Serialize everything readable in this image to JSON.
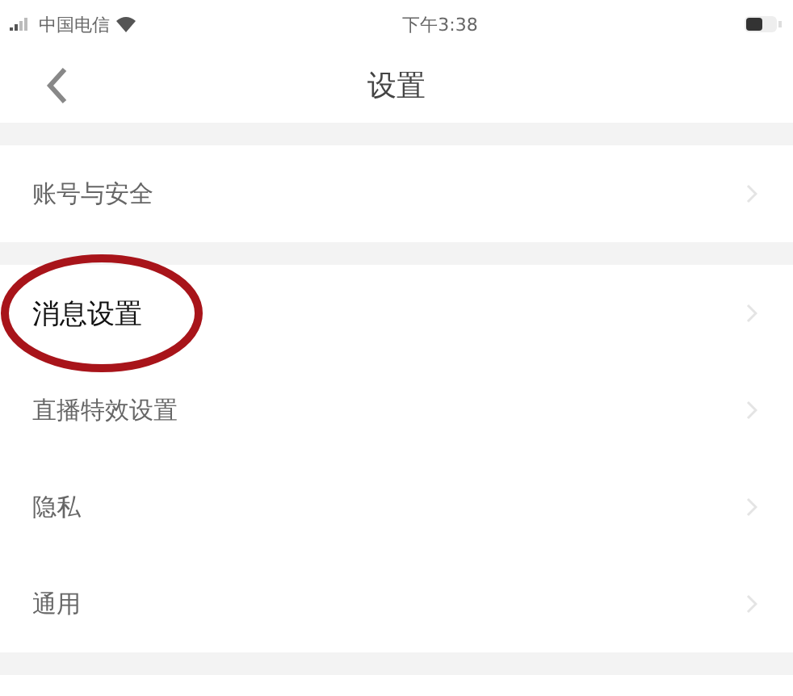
{
  "status_bar": {
    "carrier": "中国电信",
    "time": "下午3:38"
  },
  "nav": {
    "title": "设置"
  },
  "groups": [
    {
      "items": [
        {
          "label": "账号与安全",
          "highlighted": false
        }
      ]
    },
    {
      "items": [
        {
          "label": "消息设置",
          "highlighted": true
        },
        {
          "label": "直播特效设置",
          "highlighted": false
        },
        {
          "label": "隐私",
          "highlighted": false
        },
        {
          "label": "通用",
          "highlighted": false
        }
      ]
    }
  ]
}
